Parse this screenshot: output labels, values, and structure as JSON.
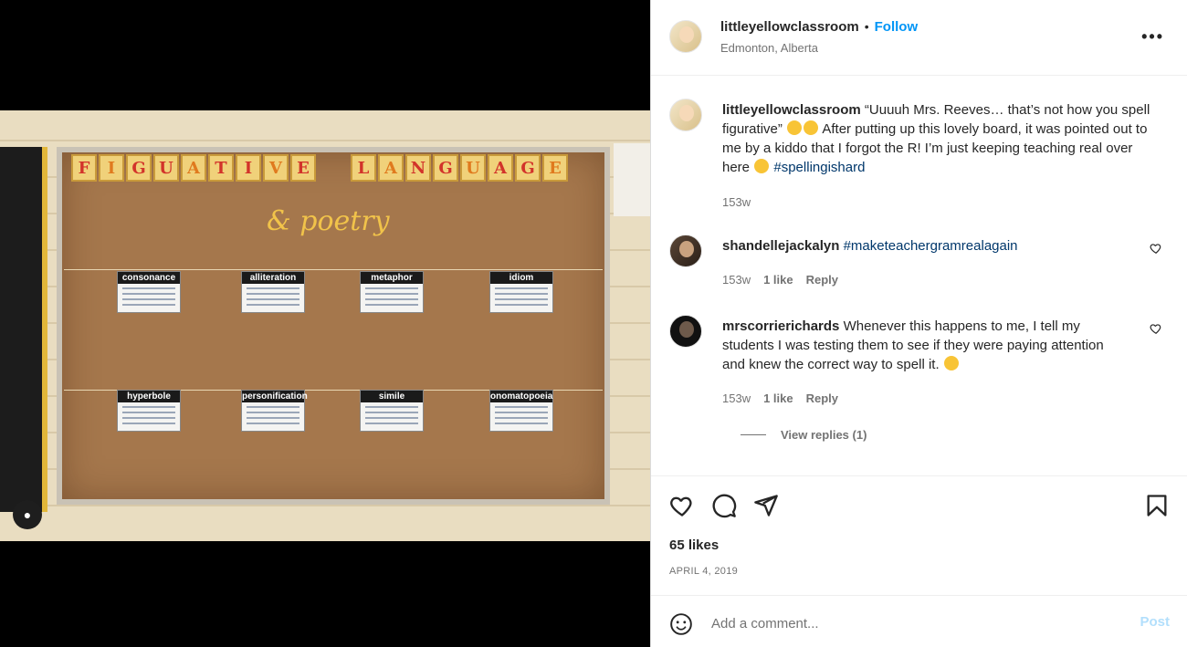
{
  "post": {
    "author": "littleyellowclassroom",
    "follow_label": "Follow",
    "location": "Edmonton, Alberta",
    "more_label": "•••"
  },
  "photo": {
    "title_word1": [
      "F",
      "I",
      "G",
      "U",
      "A",
      "T",
      "I",
      "V",
      "E"
    ],
    "title_word2": [
      "L",
      "A",
      "N",
      "G",
      "U",
      "A",
      "G",
      "E"
    ],
    "subtitle": "& poetry",
    "cards": [
      {
        "label": "consonance"
      },
      {
        "label": "alliteration"
      },
      {
        "label": "metaphor"
      },
      {
        "label": "idiom"
      },
      {
        "label": "hyperbole"
      },
      {
        "label": "personification"
      },
      {
        "label": "simile"
      },
      {
        "label": "onomatopoeia"
      }
    ]
  },
  "caption": {
    "username": "littleyellowclassroom",
    "text1": "“Uuuuh Mrs. Reeves… that’s not how you spell figurative”",
    "text2": "After putting up this lovely board, it was pointed out to me by a kiddo that I forgot the R! I’m just keeping teaching real over here",
    "hashtag": "#spellingishard",
    "age": "153w"
  },
  "comments": [
    {
      "username": "shandellejackalyn",
      "text": "#maketeachergramrealagain",
      "age": "153w",
      "likes": "1 like",
      "reply_label": "Reply"
    },
    {
      "username": "mrscorrierichards",
      "text": "Whenever this happens to me, I tell my students I was testing them to see if they were paying attention and knew the correct way to spell it.",
      "age": "153w",
      "likes": "1 like",
      "reply_label": "Reply",
      "view_replies": "View replies (1)"
    }
  ],
  "footer": {
    "likes": "65 likes",
    "date": "APRIL 4, 2019",
    "comment_placeholder": "Add a comment...",
    "post_label": "Post"
  },
  "colors": {
    "accent": "#0095f6",
    "hashtag": "#00376b",
    "post_disabled": "#b2dffc"
  }
}
